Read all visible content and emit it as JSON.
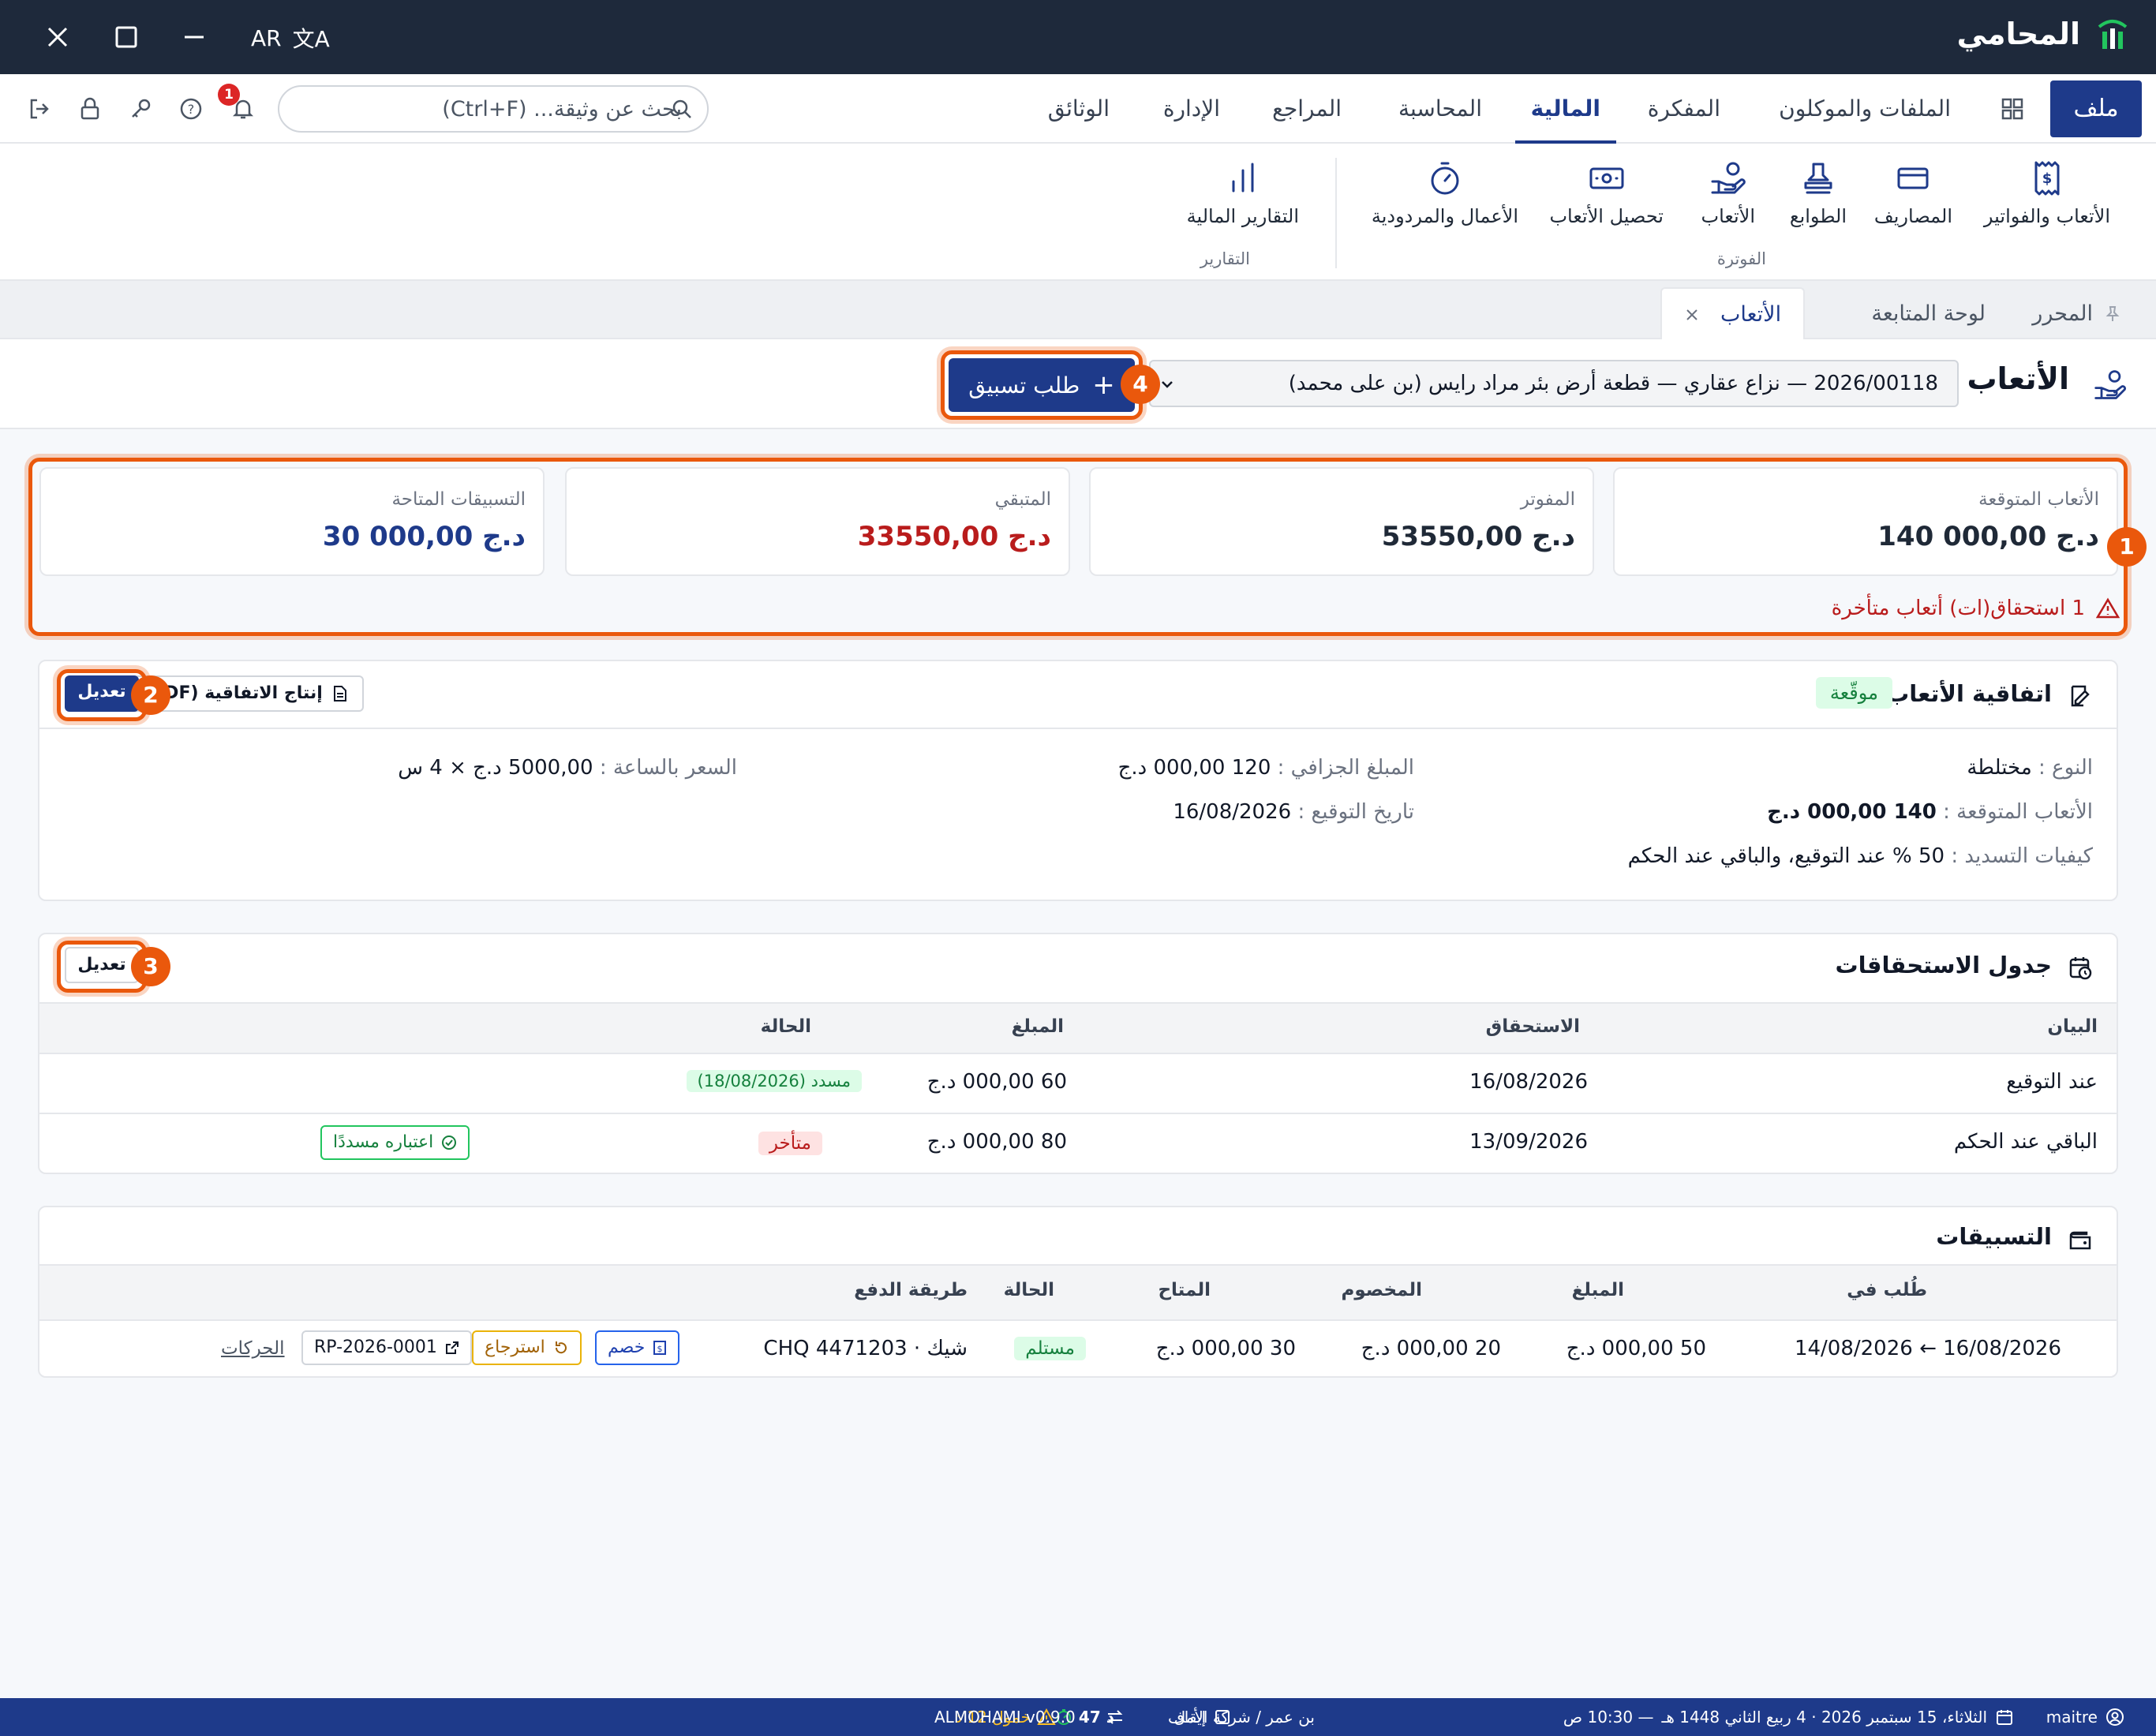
{
  "app": {
    "name": "المحامي",
    "lang": "AR"
  },
  "menu": {
    "file": "ملف",
    "items": [
      "الملفات والموكلون",
      "المفكرة",
      "المالية",
      "المحاسبة",
      "المراجع",
      "الإدارة",
      "الوثائق"
    ],
    "active": "المالية"
  },
  "search": {
    "placeholder": "بحث عن وثيقة... (Ctrl+F)"
  },
  "notifications": {
    "count": "1"
  },
  "ribbon": {
    "invoice_items": [
      "الأتعاب والفواتير",
      "المصاريف",
      "الطوابع",
      "الأتعاب",
      "تحصيل الأتعاب",
      "الأعمال والمردودية"
    ],
    "invoice_group": "الفوترة",
    "reports_items": [
      "التقارير المالية"
    ],
    "reports_group": "التقارير"
  },
  "tabs": [
    "المحرر",
    "لوحة المتابعة",
    "الأتعاب"
  ],
  "page": {
    "title": "الأتعاب",
    "case_select": "2026/00118 — نزاع عقاري — قطعة أرض بئر مراد رايس (بن على محمد)",
    "advance_button": "طلب تسبيق"
  },
  "kpis": [
    {
      "label": "الأتعاب المتوقعة",
      "value": "140 000,00 د.ج",
      "color": "#111827"
    },
    {
      "label": "المفوتر",
      "value": "53550,00 د.ج",
      "color": "#111827"
    },
    {
      "label": "المتبقي",
      "value": "33550,00 د.ج",
      "color": "#b91c1c"
    },
    {
      "label": "التسبيقات المتاحة",
      "value": "30 000,00 د.ج",
      "color": "#1e3a8a"
    }
  ],
  "overdue_alert": "1 استحقاق(ات) أتعاب متأخرة",
  "agreement": {
    "title": "اتفاقية الأتعاب",
    "status": "موقّعة",
    "edit": "تعديل",
    "pdf": "إنتاج الاتفاقية (PDF)",
    "type_label": "النوع :",
    "type_value": "مختلطة",
    "forfait_label": "المبلغ الجزافي :",
    "forfait_value": "120 000,00 د.ج",
    "hourly_label": "السعر بالساعة :",
    "hourly_value": "5000,00 د.ج × 4 س",
    "expected_label": "الأتعاب المتوقعة :",
    "expected_value": "140 000,00 د.ج",
    "sign_label": "تاريخ التوقيع :",
    "sign_value": "16/08/2026",
    "terms_label": "كيفيات التسديد :",
    "terms_value": "50 % عند التوقيع، والباقي عند الحكم"
  },
  "schedule": {
    "title": "جدول الاستحقاقات",
    "edit": "تعديل",
    "headers": [
      "البيان",
      "الاستحقاق",
      "المبلغ",
      "الحالة"
    ],
    "rows": [
      {
        "label": "عند التوقيع",
        "due": "16/08/2026",
        "amount": "60 000,00 د.ج",
        "status": "مسدد (18/08/2026)"
      },
      {
        "label": "الباقي عند الحكم",
        "due": "13/09/2026",
        "amount": "80 000,00 د.ج",
        "status": "متأخر",
        "action": "اعتباره مسددًا"
      }
    ]
  },
  "advances": {
    "title": "التسبيقات",
    "headers": [
      "طُلب في",
      "المبلغ",
      "المخصوم",
      "المتاح",
      "الحالة",
      "طريقة الدفع"
    ],
    "row": {
      "dates": "16/08/2026 ← 14/08/2026",
      "amount": "50 000,00 د.ج",
      "deducted": "20 000,00 د.ج",
      "available": "30 000,00 د.ج",
      "status": "مستلم",
      "payment": "شيك · CHQ 4471203",
      "btn_deduct": "خصم",
      "btn_refund": "استرجاع",
      "receipt": "RP-2026-0001",
      "moves": "الحركات"
    }
  },
  "callouts": [
    "1",
    "2",
    "3",
    "4"
  ],
  "statusbar": {
    "user": "maitre",
    "date": "الثلاثاء، 15 سبتمبر 2026 · 4 ربيع الثاني 1448 هـ",
    "time": "— 10:30 ص",
    "org": "بن عمر / شركة الأمل",
    "count": "د 47",
    "dormant": "خمول 12 د",
    "pause": "إيقاف",
    "version": "ALMOHAMI v0.9.0"
  }
}
